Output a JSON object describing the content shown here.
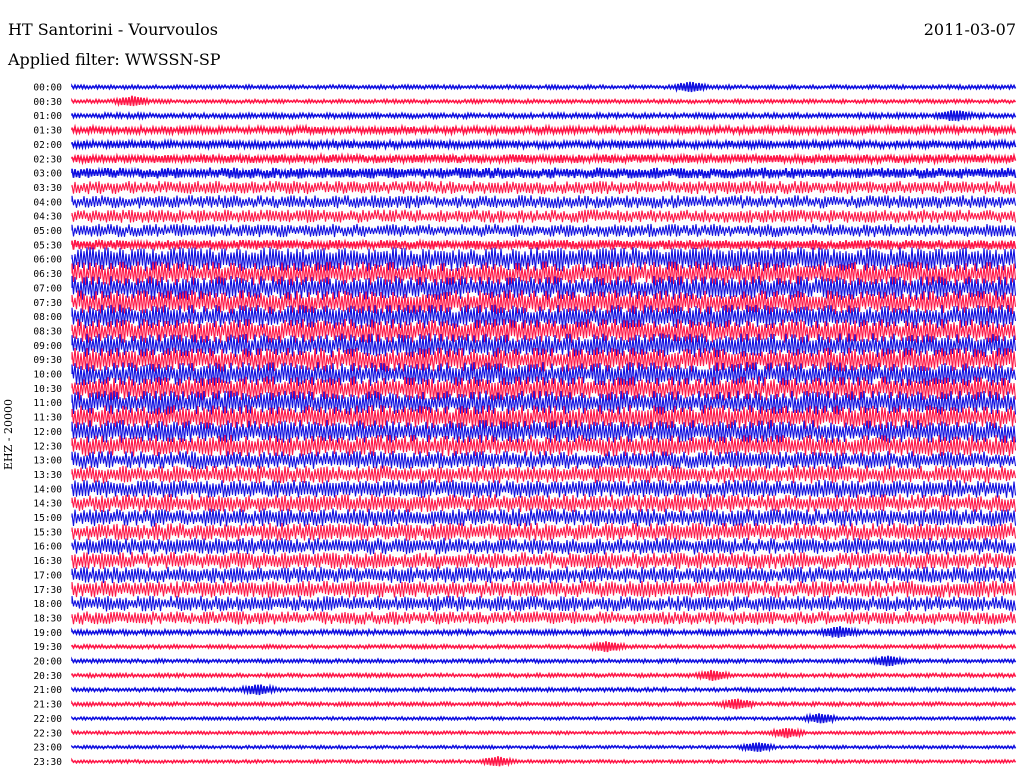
{
  "header": {
    "station": "HT Santorini - Vourvoulos",
    "date": "2011-03-07",
    "filter": "Applied filter: WWSSN-SP",
    "channel": "EHZ - 20000"
  },
  "colors": {
    "trace_a": "#1010e0",
    "trace_b": "#ff1848"
  },
  "chart_data": {
    "type": "line",
    "title": "HT Santorini - Vourvoulos",
    "subtitle": "Applied filter: WWSSN-SP",
    "date": "2011-03-07",
    "ylabel": "EHZ - 20000",
    "row_labels": [
      "00:00",
      "00:30",
      "01:00",
      "01:30",
      "02:00",
      "02:30",
      "03:00",
      "03:30",
      "04:00",
      "04:30",
      "05:00",
      "05:30",
      "06:00",
      "06:30",
      "07:00",
      "07:30",
      "08:00",
      "08:30",
      "09:00",
      "09:30",
      "10:00",
      "10:30",
      "11:00",
      "11:30",
      "12:00",
      "12:30",
      "13:00",
      "13:30",
      "14:00",
      "14:30",
      "15:00",
      "15:30",
      "16:00",
      "16:30",
      "17:00",
      "17:30",
      "18:00",
      "18:30",
      "19:00",
      "19:30",
      "20:00",
      "20:30",
      "21:00",
      "21:30",
      "22:00",
      "22:30",
      "23:00",
      "23:30"
    ],
    "trace_colors": [
      "blue",
      "red"
    ],
    "relative_amplitude": [
      0.15,
      0.15,
      0.2,
      0.3,
      0.3,
      0.35,
      0.45,
      0.55,
      0.55,
      0.55,
      0.55,
      0.4,
      1.0,
      1.0,
      1.0,
      1.0,
      1.0,
      1.0,
      1.0,
      1.0,
      1.0,
      1.0,
      1.0,
      1.0,
      0.95,
      0.9,
      0.75,
      0.75,
      0.75,
      0.75,
      0.75,
      0.75,
      0.7,
      0.7,
      0.7,
      0.7,
      0.65,
      0.55,
      0.2,
      0.15,
      0.15,
      0.15,
      0.15,
      0.15,
      0.12,
      0.12,
      0.12,
      0.12
    ]
  }
}
